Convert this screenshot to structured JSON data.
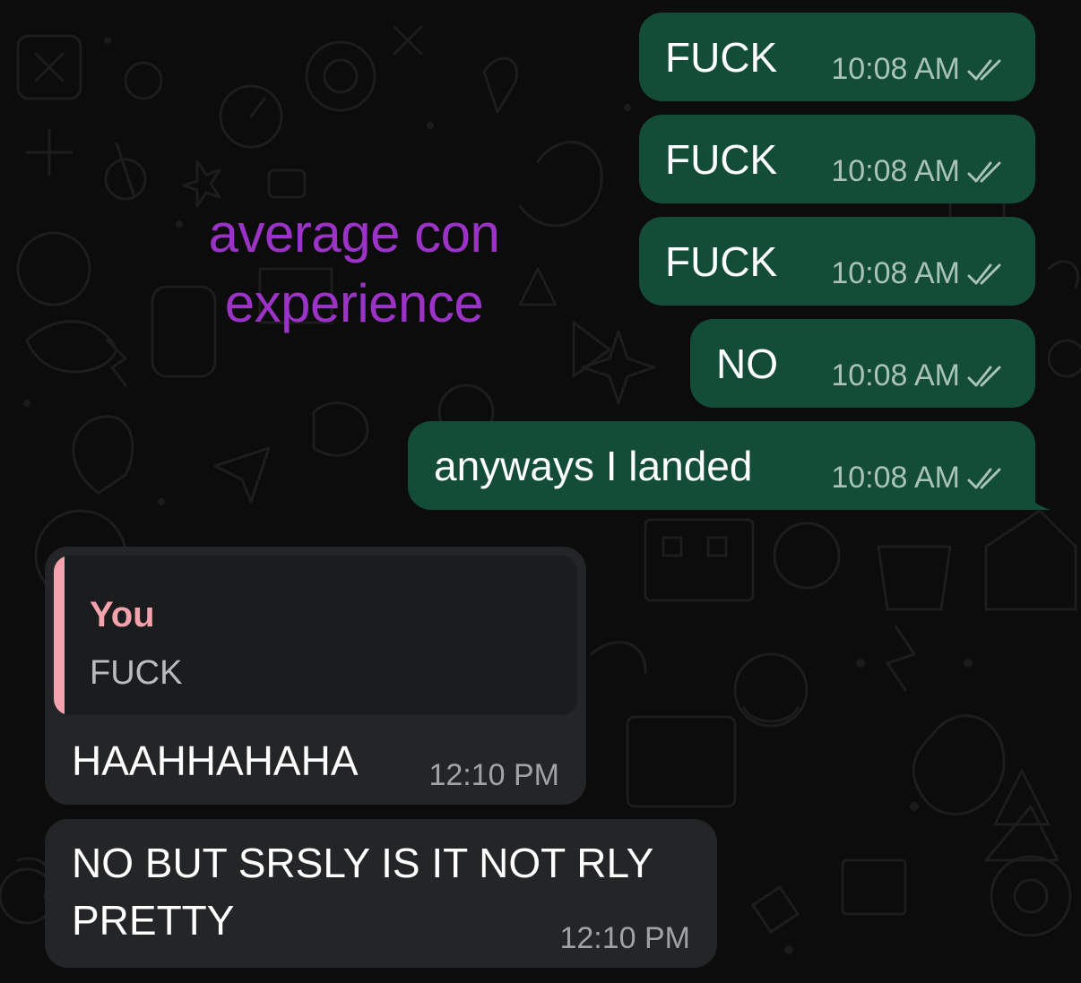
{
  "caption": {
    "line1": "average con",
    "line2": "experience"
  },
  "outgoing": [
    {
      "text": "FUCK",
      "time": "10:08 AM",
      "status_icon": "double-check-icon"
    },
    {
      "text": "FUCK",
      "time": "10:08 AM",
      "status_icon": "double-check-icon"
    },
    {
      "text": "FUCK",
      "time": "10:08 AM",
      "status_icon": "double-check-icon"
    },
    {
      "text": "NO",
      "time": "10:08 AM",
      "status_icon": "double-check-icon"
    },
    {
      "text": "anyways I landed",
      "time": "10:08 AM",
      "status_icon": "double-check-icon"
    }
  ],
  "incoming": [
    {
      "reply_to": {
        "author": "You",
        "text": "FUCK"
      },
      "text": "HAAHHAHAHA",
      "time": "12:10 PM"
    },
    {
      "text_line1": "NO BUT SRSLY IS IT NOT RLY",
      "text_line2": "PRETTY",
      "time": "12:10 PM"
    }
  ],
  "colors": {
    "outgoing_bubble": "#144d37",
    "incoming_bubble": "#232526",
    "reply_accent": "#f3a3ad",
    "caption": "#9a33c6",
    "background": "#0c0c0c"
  }
}
